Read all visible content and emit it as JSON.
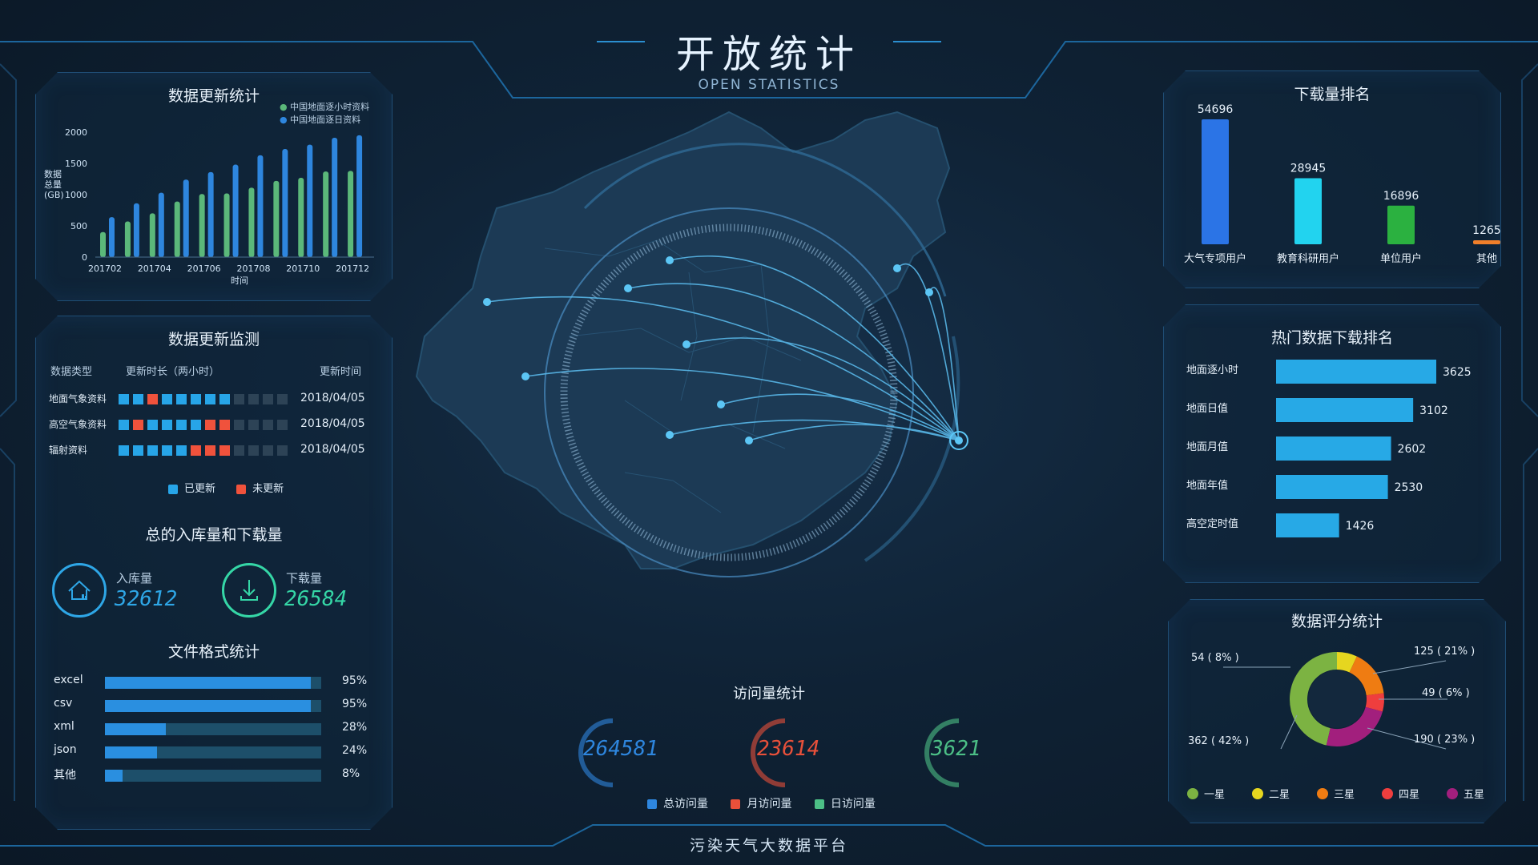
{
  "header": {
    "title": "开放统计",
    "subtitle": "OPEN STATISTICS"
  },
  "footer": {
    "text": "污染天气大数据平台"
  },
  "update_stats": {
    "title": "数据更新统计",
    "legend": [
      "中国地面逐小时资料",
      "中国地面逐日资料"
    ],
    "y_axis_title": "数据总量(GB)",
    "x_axis_title": "时间",
    "colors": {
      "hourly": "#5bb87a",
      "daily": "#2e86de"
    }
  },
  "monitor": {
    "title": "数据更新监测",
    "headers": [
      "数据类型",
      "更新时长（两小时）",
      "更新时间"
    ],
    "rows": [
      {
        "name": "地面气象资料",
        "cells": [
          "u",
          "u",
          "n",
          "u",
          "u",
          "u",
          "u",
          "u",
          "e",
          "e",
          "e",
          "e"
        ],
        "time": "2018/04/05"
      },
      {
        "name": "高空气象资料",
        "cells": [
          "u",
          "n",
          "u",
          "u",
          "u",
          "u",
          "n",
          "n",
          "e",
          "e",
          "e",
          "e"
        ],
        "time": "2018/04/05"
      },
      {
        "name": "辐射资料",
        "cells": [
          "u",
          "u",
          "u",
          "u",
          "u",
          "n",
          "n",
          "n",
          "e",
          "e",
          "e",
          "e"
        ],
        "time": "2018/04/05"
      }
    ],
    "legend_updated": "已更新",
    "legend_not_updated": "未更新"
  },
  "totals": {
    "title": "总的入库量和下载量",
    "in_label": "入库量",
    "in_value": "32612",
    "down_label": "下载量",
    "down_value": "26584"
  },
  "file_formats": {
    "title": "文件格式统计",
    "items": [
      {
        "name": "excel",
        "percent": 95,
        "label": "95%"
      },
      {
        "name": "csv",
        "percent": 95,
        "label": "95%"
      },
      {
        "name": "xml",
        "percent": 28,
        "label": "28%"
      },
      {
        "name": "json",
        "percent": 24,
        "label": "24%"
      },
      {
        "name": "其他",
        "percent": 8,
        "label": "8%"
      }
    ]
  },
  "visits": {
    "title": "访问量统计",
    "total": "264581",
    "monthly": "23614",
    "daily": "3621",
    "legend": [
      "总访问量",
      "月访问量",
      "日访问量"
    ],
    "colors": {
      "total": "#2e86de",
      "monthly": "#e8503a",
      "daily": "#4cbf86"
    }
  },
  "download_rank": {
    "title": "下载量排名",
    "colors": [
      "#2b74e6",
      "#22d3ef",
      "#2bb140",
      "#f07f2a"
    ]
  },
  "hot_rank": {
    "title": "热门数据下载排名"
  },
  "rating": {
    "title": "数据评分统计",
    "labels": [
      "54 ( 8% )",
      "125 ( 21% )",
      "49 ( 6% )",
      "190 ( 23% )",
      "362 ( 42% )"
    ],
    "colors": [
      "#7cb342",
      "#e6d61f",
      "#ef7c12",
      "#ef3e3e",
      "#a21f7d"
    ]
  },
  "chart_data": [
    {
      "type": "bar",
      "title": "数据更新统计",
      "xlabel": "时间",
      "ylabel": "数据总量(GB)",
      "ylim": [
        0,
        2000
      ],
      "yticks": [
        0,
        500,
        1000,
        1500,
        2000
      ],
      "categories": [
        "201702",
        "201703",
        "201704",
        "201705",
        "201706",
        "201707",
        "201708",
        "201709",
        "201710",
        "201711",
        "201712"
      ],
      "x_tick_labels": [
        "201702",
        "201704",
        "201706",
        "201708",
        "201710",
        "201712"
      ],
      "series": [
        {
          "name": "中国地面逐小时资料",
          "values": [
            400,
            570,
            700,
            890,
            1010,
            1020,
            1110,
            1220,
            1270,
            1370,
            1380
          ]
        },
        {
          "name": "中国地面逐日资料",
          "values": [
            640,
            860,
            1030,
            1240,
            1360,
            1480,
            1630,
            1730,
            1800,
            1910,
            1950
          ]
        }
      ]
    },
    {
      "type": "bar",
      "title": "下载量排名",
      "categories": [
        "大气专项用户",
        "教育科研用户",
        "单位用户",
        "其他"
      ],
      "values": [
        54696,
        28945,
        16896,
        1265
      ],
      "value_labels": [
        "54696",
        "28945",
        "16896",
        "1265"
      ]
    },
    {
      "type": "bar",
      "title": "热门数据下载排名",
      "categories": [
        "地面逐小时",
        "地面日值",
        "地面月值",
        "地面年值",
        "高空定时值"
      ],
      "values": [
        3625,
        3102,
        2602,
        2530,
        1426
      ],
      "value_labels": [
        "3625",
        "3102",
        "2602",
        "2530",
        "1426"
      ]
    },
    {
      "type": "pie",
      "title": "数据评分统计",
      "categories": [
        "一星",
        "二星",
        "三星",
        "四星",
        "五星"
      ],
      "values": [
        362,
        54,
        125,
        49,
        190
      ],
      "percents": [
        42,
        8,
        21,
        6,
        23
      ]
    }
  ]
}
